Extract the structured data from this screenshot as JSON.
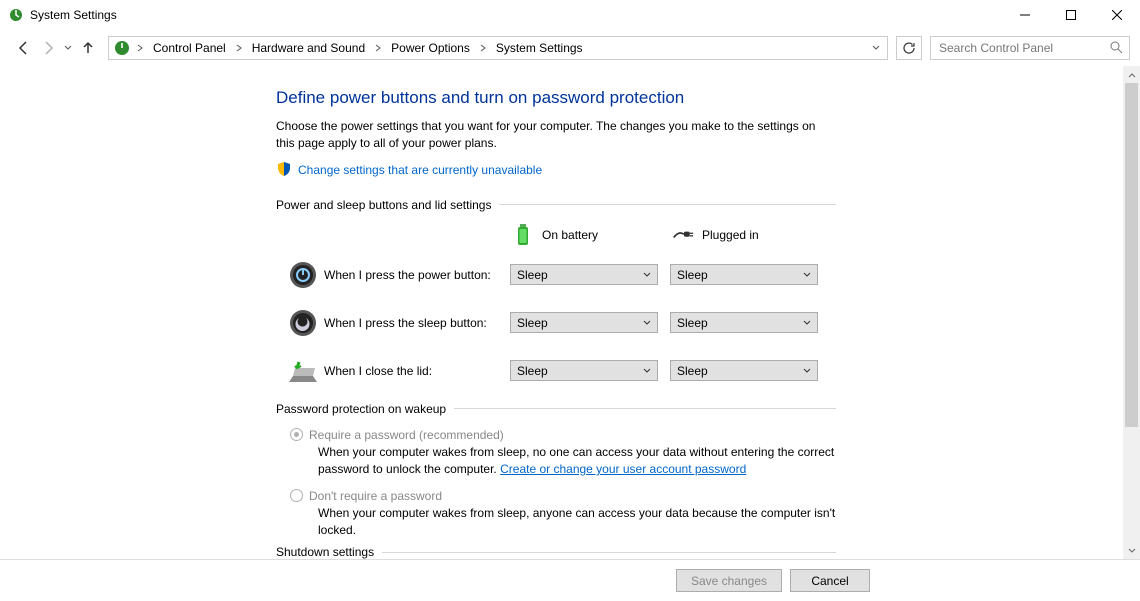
{
  "window": {
    "title": "System Settings"
  },
  "breadcrumb": {
    "items": [
      "Control Panel",
      "Hardware and Sound",
      "Power Options",
      "System Settings"
    ]
  },
  "search": {
    "placeholder": "Search Control Panel"
  },
  "page": {
    "heading": "Define power buttons and turn on password protection",
    "description": "Choose the power settings that you want for your computer. The changes you make to the settings on this page apply to all of your power plans.",
    "change_link": "Change settings that are currently unavailable"
  },
  "group_buttons": {
    "title": "Power and sleep buttons and lid settings",
    "cols": {
      "battery": "On battery",
      "plugged": "Plugged in"
    },
    "rows": [
      {
        "label": "When I press the power button:",
        "battery": "Sleep",
        "plugged": "Sleep"
      },
      {
        "label": "When I press the sleep button:",
        "battery": "Sleep",
        "plugged": "Sleep"
      },
      {
        "label": "When I close the lid:",
        "battery": "Sleep",
        "plugged": "Sleep"
      }
    ]
  },
  "group_password": {
    "title": "Password protection on wakeup",
    "opt1": {
      "label": "Require a password (recommended)",
      "desc_a": "When your computer wakes from sleep, no one can access your data without entering the correct password to unlock the computer. ",
      "link": "Create or change your user account password"
    },
    "opt2": {
      "label": "Don't require a password",
      "desc": "When your computer wakes from sleep, anyone can access your data because the computer isn't locked."
    }
  },
  "group_shutdown": {
    "title": "Shutdown settings"
  },
  "footer": {
    "save": "Save changes",
    "cancel": "Cancel"
  }
}
